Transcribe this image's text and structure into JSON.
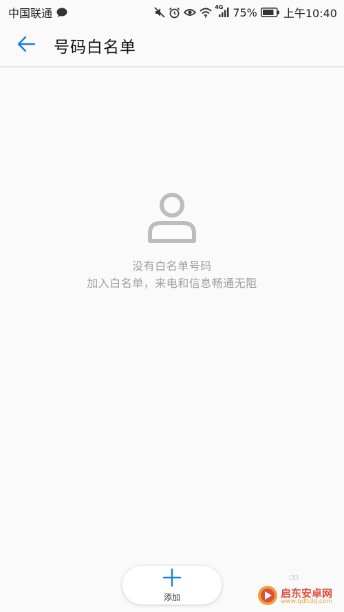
{
  "status_bar": {
    "carrier": "中国联通",
    "battery_percent": "75%",
    "time": "上午10:40",
    "network_type": "4G",
    "icons": [
      "message-bubble-icon",
      "mute-icon",
      "alarm-icon",
      "eye-icon",
      "wifi-icon",
      "signal-icon",
      "battery-icon"
    ]
  },
  "header": {
    "title": "号码白名单",
    "back_icon": "back-arrow-icon"
  },
  "empty_state": {
    "icon": "person-icon",
    "title": "没有白名单号码",
    "subtitle": "加入白名单，来电和信息畅通无阻"
  },
  "add_button": {
    "label": "添加",
    "icon": "plus-icon"
  },
  "watermark": {
    "brand": "启东安卓网",
    "url": "www.qdltdq.com"
  },
  "colors": {
    "accent": "#1a7fd8",
    "background": "#fafafa",
    "muted_text": "#9e9e9e",
    "icon_gray": "#bdbdbd"
  }
}
